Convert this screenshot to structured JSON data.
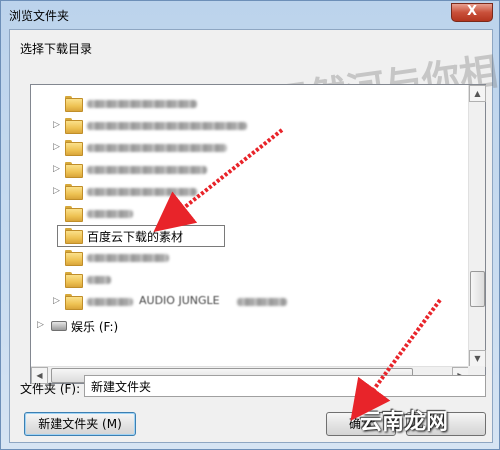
{
  "window": {
    "title": "浏览文件夹",
    "close_symbol": "X"
  },
  "dialog": {
    "instruction": "选择下载目录",
    "watermark": "天然河与你相",
    "folder_label": "文件夹 (F):",
    "folder_value": "新建文件夹",
    "new_folder_button": "新建文件夹 (M)",
    "ok_button": "确定",
    "cancel_button": "",
    "brand": "云南龙网"
  },
  "tree": {
    "items": [
      {
        "label": "",
        "blurred": true,
        "expandable": false
      },
      {
        "label": "",
        "blurred": true,
        "expandable": true
      },
      {
        "label": "",
        "blurred": true,
        "expandable": true
      },
      {
        "label": "",
        "blurred": true,
        "expandable": true
      },
      {
        "label": "",
        "blurred": true,
        "expandable": true
      },
      {
        "label": "",
        "blurred": true,
        "expandable": false
      },
      {
        "label": "百度云下载的素材",
        "blurred": false,
        "expandable": false,
        "selected": true
      },
      {
        "label": "",
        "blurred": true,
        "expandable": false
      },
      {
        "label": "",
        "blurred": true,
        "expandable": false
      },
      {
        "label": "AUDIO JUNGLE",
        "blurred": true,
        "expandable": true
      }
    ],
    "drive": {
      "label": "娱乐 (F:)"
    }
  },
  "colors": {
    "annotation_arrow": "#e8242a",
    "brand_text": "#ffffff"
  }
}
